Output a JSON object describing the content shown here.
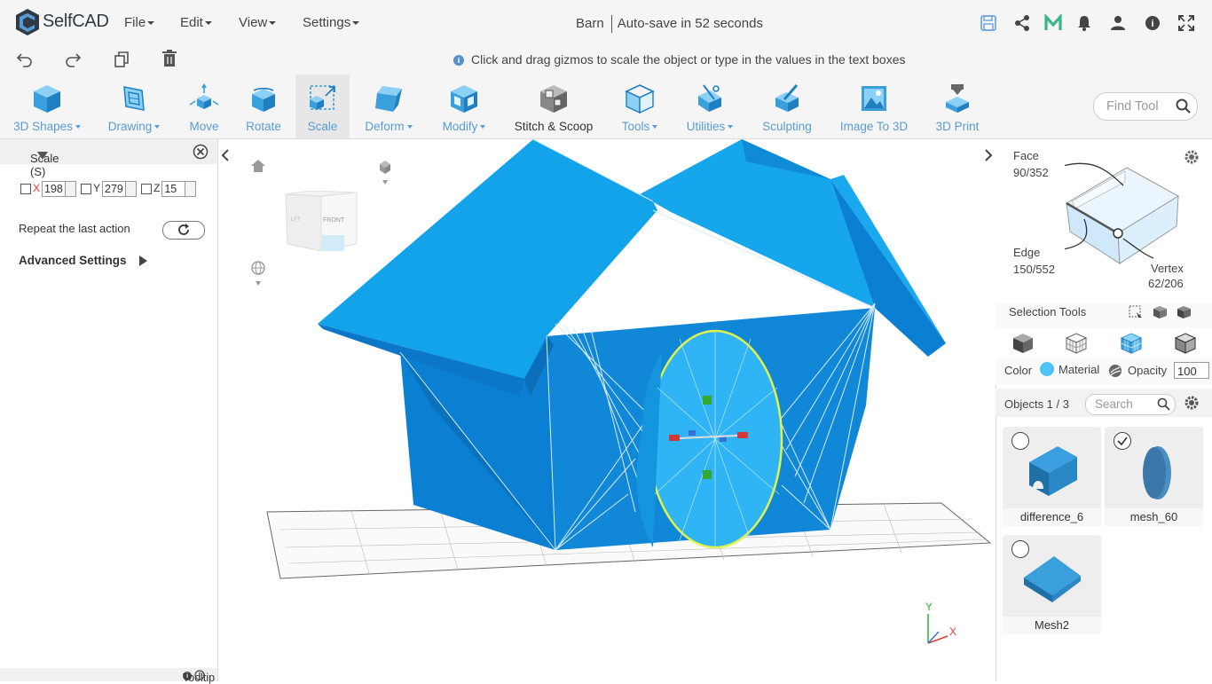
{
  "app": {
    "name": "SelfCAD",
    "brand_color": "#2f3a45",
    "accent_color": "#5b9bd5"
  },
  "menus": [
    {
      "label": "File"
    },
    {
      "label": "Edit"
    },
    {
      "label": "View"
    },
    {
      "label": "Settings"
    }
  ],
  "project": {
    "name": "Barn",
    "autosave": "Auto-save in 52 seconds"
  },
  "hint": "Click and drag gizmos to scale the object or type in the values in the text boxes",
  "toolbar": {
    "tools": [
      {
        "label": "3D Shapes",
        "icon": "cube-icon",
        "dropdown": true
      },
      {
        "label": "Drawing",
        "icon": "drawing-icon",
        "dropdown": true
      },
      {
        "label": "Move",
        "icon": "move-icon",
        "dropdown": false
      },
      {
        "label": "Rotate",
        "icon": "rotate-icon",
        "dropdown": false
      },
      {
        "label": "Scale",
        "icon": "scale-icon",
        "dropdown": false,
        "active": true
      },
      {
        "label": "Deform",
        "icon": "deform-icon",
        "dropdown": true
      },
      {
        "label": "Modify",
        "icon": "modify-icon",
        "dropdown": true
      },
      {
        "label": "Stitch & Scoop",
        "icon": "stitch-scoop-icon",
        "dropdown": false
      },
      {
        "label": "Tools",
        "icon": "tools-icon",
        "dropdown": true
      },
      {
        "label": "Utilities",
        "icon": "utilities-icon",
        "dropdown": true
      },
      {
        "label": "Sculpting",
        "icon": "sculpting-icon",
        "dropdown": false
      },
      {
        "label": "Image To 3D",
        "icon": "image-to-3d-icon",
        "dropdown": false
      },
      {
        "label": "3D Print",
        "icon": "3d-print-icon",
        "dropdown": false
      }
    ],
    "find_tool_placeholder": "Find Tool"
  },
  "scale_panel": {
    "title": "Scale (S)",
    "x_label": "X",
    "x_value": "198",
    "y_label": "Y",
    "y_value": "279",
    "z_label": "Z",
    "z_value": "15",
    "repeat_label": "Repeat the last action",
    "advanced_label": "Advanced Settings",
    "tooltip_label": "Tooltip"
  },
  "viewcube": {
    "front": "FRONT",
    "left": "LFT"
  },
  "axes": {
    "y": "Y",
    "x": "X"
  },
  "selection": {
    "face_label": "Face",
    "face_count": "90/352",
    "edge_label": "Edge",
    "edge_count": "150/552",
    "vertex_label": "Vertex",
    "vertex_count": "62/206",
    "tools_label": "Selection Tools"
  },
  "appearance": {
    "color_label": "Color",
    "color_value": "#4fc3f7",
    "material_label": "Material",
    "opacity_label": "Opacity",
    "opacity_value": "100"
  },
  "objects": {
    "header": "Objects 1 / 3",
    "search_placeholder": "Search",
    "items": [
      {
        "name": "difference_6",
        "selected": false
      },
      {
        "name": "mesh_60",
        "selected": true
      },
      {
        "name": "Mesh2",
        "selected": false
      }
    ]
  }
}
